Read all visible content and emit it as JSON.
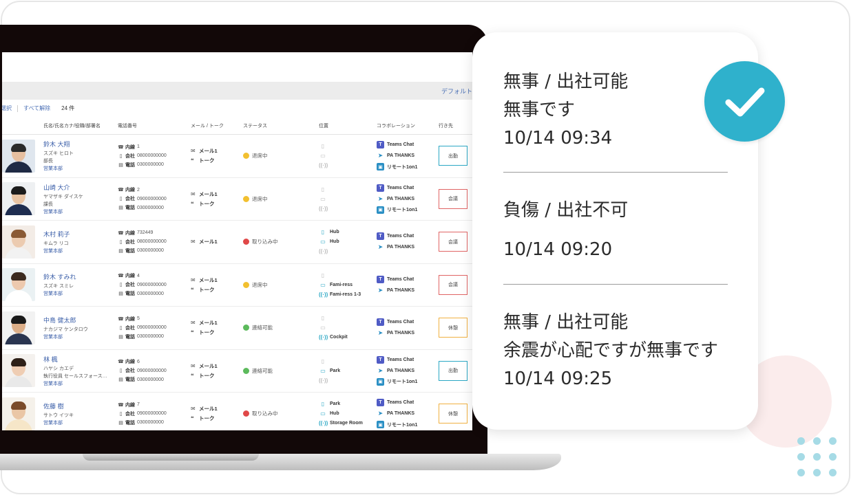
{
  "toolbar": {
    "select_label": "選択",
    "clear_label": "すべて解除",
    "count": "24 件",
    "default_label": "デフォルト"
  },
  "columns": [
    "氏名/氏名カナ/役職/部署名",
    "電話番号",
    "メール / トーク",
    "ステータス",
    "位置",
    "コラボレーション",
    "行き先"
  ],
  "rows": [
    {
      "name": "鈴木 大翔",
      "kana": "スズキ ヒロト",
      "title": "部長",
      "dept": "営業本部",
      "ext": "1",
      "mobile": "08000000000",
      "tel": "0300000000",
      "mail": "メール1",
      "talk": "トーク",
      "status": "退席中",
      "status_color": "#f2c030",
      "loc": [
        {
          "icon": "phone",
          "active": false,
          "label": ""
        },
        {
          "icon": "monitor",
          "active": false,
          "label": ""
        },
        {
          "icon": "signal",
          "active": false,
          "label": ""
        }
      ],
      "collab": [
        {
          "icon": "teams",
          "label": "Teams Chat"
        },
        {
          "icon": "pa",
          "label": "PA THANKS"
        },
        {
          "icon": "remote",
          "label": "リモート1on1"
        }
      ],
      "dest": "出勤",
      "dest_color": "#2aa7c4",
      "photo": {
        "bg": "#dfe6ee",
        "skin": "#e6bfa0",
        "hair": "#2a2a2a",
        "suit": "#1f2a44"
      }
    },
    {
      "name": "山崎 大介",
      "kana": "ヤマザキ ダイスケ",
      "title": "課長",
      "dept": "営業本部",
      "ext": "2",
      "mobile": "09000000000",
      "tel": "0300000000",
      "mail": "メール1",
      "talk": "トーク",
      "status": "退席中",
      "status_color": "#f2c030",
      "loc": [
        {
          "icon": "phone",
          "active": false,
          "label": ""
        },
        {
          "icon": "monitor",
          "active": false,
          "label": ""
        },
        {
          "icon": "signal",
          "active": false,
          "label": ""
        }
      ],
      "collab": [
        {
          "icon": "teams",
          "label": "Teams Chat"
        },
        {
          "icon": "pa",
          "label": "PA THANKS"
        },
        {
          "icon": "remote",
          "label": "リモート1on1"
        }
      ],
      "dest": "会議",
      "dest_color": "#e06464",
      "photo": {
        "bg": "#eef0f2",
        "skin": "#e8c4a4",
        "hair": "#1c1c1c",
        "suit": "#1e2d50"
      }
    },
    {
      "name": "木村 莉子",
      "kana": "キムラ リコ",
      "title": "",
      "dept": "営業本部",
      "ext": "732449",
      "mobile": "08000000000",
      "tel": "0300000000",
      "mail": "メール1",
      "talk": "",
      "status": "取り込み中",
      "status_color": "#e04848",
      "loc": [
        {
          "icon": "phone",
          "active": true,
          "label": "Hub"
        },
        {
          "icon": "monitor",
          "active": true,
          "label": "Hub"
        },
        {
          "icon": "signal",
          "active": false,
          "label": ""
        }
      ],
      "collab": [
        {
          "icon": "teams",
          "label": "Teams Chat"
        },
        {
          "icon": "pa",
          "label": "PA THANKS"
        }
      ],
      "dest": "会議",
      "dest_color": "#e06464",
      "photo": {
        "bg": "#f3ece6",
        "skin": "#eccbb0",
        "hair": "#8a5a35",
        "suit": "#f2f2f2"
      }
    },
    {
      "name": "鈴木 すみれ",
      "kana": "スズキ スミレ",
      "title": "",
      "dept": "営業本部",
      "ext": "4",
      "mobile": "09000000000",
      "tel": "0300000000",
      "mail": "メール1",
      "talk": "トーク",
      "status": "退席中",
      "status_color": "#f2c030",
      "loc": [
        {
          "icon": "phone",
          "active": false,
          "label": ""
        },
        {
          "icon": "monitor",
          "active": true,
          "label": "Fami-ress"
        },
        {
          "icon": "signal",
          "active": true,
          "label": "Fami-ress 1-3"
        }
      ],
      "collab": [
        {
          "icon": "teams",
          "label": "Teams Chat"
        },
        {
          "icon": "pa",
          "label": "PA THANKS"
        }
      ],
      "dest": "会議",
      "dest_color": "#e06464",
      "photo": {
        "bg": "#eaf1f3",
        "skin": "#edc9ae",
        "hair": "#3b2a1f",
        "suit": "#ffffff"
      }
    },
    {
      "name": "中島 健太郎",
      "kana": "ナカジマ ケンタロウ",
      "title": "",
      "dept": "営業本部",
      "ext": "5",
      "mobile": "09000000000",
      "tel": "0300000000",
      "mail": "メール1",
      "talk": "トーク",
      "status": "連絡可能",
      "status_color": "#5cba5c",
      "loc": [
        {
          "icon": "phone",
          "active": false,
          "label": ""
        },
        {
          "icon": "monitor",
          "active": false,
          "label": ""
        },
        {
          "icon": "signal",
          "active": true,
          "label": "Cockpit"
        }
      ],
      "collab": [
        {
          "icon": "teams",
          "label": "Teams Chat"
        },
        {
          "icon": "pa",
          "label": "PA THANKS"
        }
      ],
      "dest": "休憩",
      "dest_color": "#f0b040",
      "photo": {
        "bg": "#f2f2f2",
        "skin": "#dcae88",
        "hair": "#1a1a1a",
        "suit": "#2a3550"
      }
    },
    {
      "name": "林 楓",
      "kana": "ハヤシ カエデ",
      "title": "執行役員 セールスフォース…",
      "dept": "営業本部",
      "ext": "6",
      "mobile": "09000000000",
      "tel": "0300000000",
      "mail": "メール1",
      "talk": "トーク",
      "status": "連絡可能",
      "status_color": "#5cba5c",
      "loc": [
        {
          "icon": "phone",
          "active": false,
          "label": ""
        },
        {
          "icon": "monitor",
          "active": true,
          "label": "Park"
        },
        {
          "icon": "signal",
          "active": false,
          "label": ""
        }
      ],
      "collab": [
        {
          "icon": "teams",
          "label": "Teams Chat"
        },
        {
          "icon": "pa",
          "label": "PA THANKS"
        },
        {
          "icon": "remote",
          "label": "リモート1on1"
        }
      ],
      "dest": "出勤",
      "dest_color": "#2aa7c4",
      "photo": {
        "bg": "#f4f1ee",
        "skin": "#efcdb3",
        "hair": "#2e2018",
        "suit": "#e9e9e9"
      }
    },
    {
      "name": "佐藤 樹",
      "kana": "サトウ イツキ",
      "title": "",
      "dept": "営業本部",
      "ext": "7",
      "mobile": "09000000000",
      "tel": "0300000000",
      "mail": "メール1",
      "talk": "トーク",
      "status": "取り込み中",
      "status_color": "#e04848",
      "loc": [
        {
          "icon": "phone",
          "active": true,
          "label": "Park"
        },
        {
          "icon": "monitor",
          "active": true,
          "label": "Hub"
        },
        {
          "icon": "signal",
          "active": true,
          "label": "Storage Room"
        }
      ],
      "collab": [
        {
          "icon": "teams",
          "label": "Teams Chat"
        },
        {
          "icon": "pa",
          "label": "PA THANKS"
        },
        {
          "icon": "remote",
          "label": "リモート1on1"
        }
      ],
      "dest": "休憩",
      "dest_color": "#f0b040",
      "photo": {
        "bg": "#f5f1ea",
        "skin": "#eac6a6",
        "hair": "#7a4b2a",
        "suit": "#f6e6c8"
      }
    }
  ],
  "phone_labels": {
    "ext": "内線",
    "mobile": "会社",
    "tel": "電話"
  },
  "card": {
    "entry1": {
      "title": "無事 / 出社可能",
      "message": "無事です",
      "time": "10/14 09:34"
    },
    "entry2": {
      "title": "負傷 / 出社不可",
      "message": "",
      "time": "10/14 09:20"
    },
    "entry3": {
      "title": "無事 / 出社可能",
      "message": "余震が心配ですが無事です",
      "time": "10/14 09:25"
    }
  },
  "colors": {
    "accent": "#2fb1cc",
    "link": "#3a5ea8",
    "bezel": "#120808"
  },
  "icons": {
    "check": "check-icon"
  }
}
